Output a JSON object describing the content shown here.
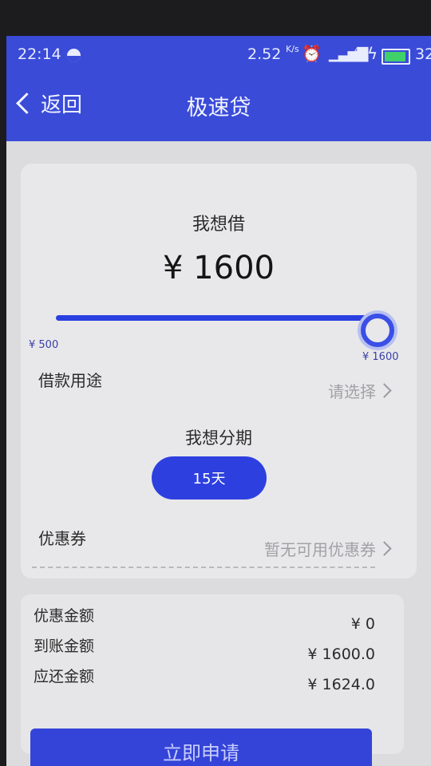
{
  "status_bar": {
    "time": "22:14",
    "net_speed": "2.52",
    "net_unit": "K/s",
    "network_type": "4G",
    "battery_level": "32"
  },
  "nav": {
    "back_label": "返回",
    "title": "极速贷"
  },
  "loan": {
    "want_label": "我想借",
    "amount": "¥ 1600",
    "slider_min_label": "¥ 500",
    "slider_max_label": "¥ 1600",
    "slider_value_fraction": 1.0,
    "purpose_label": "借款用途",
    "purpose_value": "请选择",
    "period_label": "我想分期",
    "period_option": "15天",
    "coupon_label": "优惠券",
    "coupon_value": "暂无可用优惠券"
  },
  "summary": {
    "discount_label": "优惠金额",
    "discount_value": "¥ 0",
    "received_label": "到账金额",
    "received_value": "¥ 1600.0",
    "repay_label": "应还金额",
    "repay_value": "¥ 1624.0"
  },
  "apply_label": "立即申请",
  "colors": {
    "primary": "#3a4bd8",
    "button": "#2e3fe0",
    "battery": "#3fd06a"
  }
}
